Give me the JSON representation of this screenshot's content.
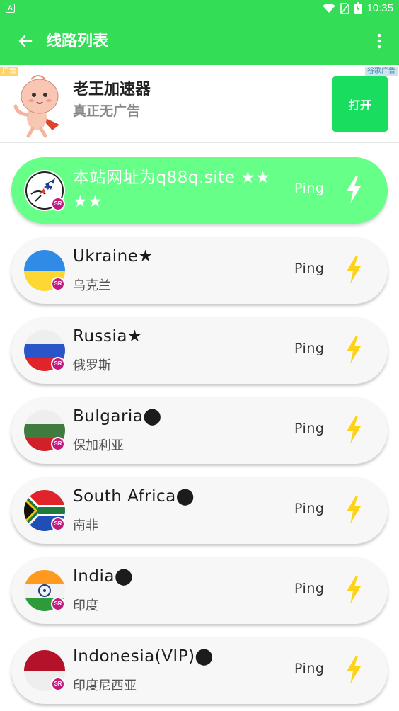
{
  "status_bar": {
    "time": "10:35",
    "app_icon_letter": "A"
  },
  "app_bar": {
    "title": "线路列表",
    "back_icon": "arrow-left-icon",
    "menu_icon": "more-vert-icon"
  },
  "ad": {
    "tag_left": "广告",
    "tag_right": "谷歌广告",
    "title": "老王加速器",
    "subtitle": "真正无广告",
    "button_label": "打开"
  },
  "colors": {
    "primary": "#33dd55",
    "active_card": "#66ff88",
    "bolt_yellow": "#ffd21a",
    "sr_badge": "#c21a7e"
  },
  "servers": [
    {
      "name": "本站网址为q88q.site ★★ ★★",
      "sub": "",
      "ping_label": "Ping",
      "badge": "SR",
      "flag": "rocket",
      "active": true
    },
    {
      "name": "Ukraine★",
      "sub": "乌克兰",
      "ping_label": "Ping",
      "badge": "SR",
      "flag": "ukraine",
      "active": false
    },
    {
      "name": "Russia★",
      "sub": "俄罗斯",
      "ping_label": "Ping",
      "badge": "SR",
      "flag": "russia",
      "active": false
    },
    {
      "name": "Bulgaria⬤",
      "sub": "保加利亚",
      "ping_label": "Ping",
      "badge": "SR",
      "flag": "bulgaria",
      "active": false
    },
    {
      "name": "South Africa⬤",
      "sub": "南非",
      "ping_label": "Ping",
      "badge": "SR",
      "flag": "south-africa",
      "active": false
    },
    {
      "name": "India⬤",
      "sub": "印度",
      "ping_label": "Ping",
      "badge": "SR",
      "flag": "india",
      "active": false
    },
    {
      "name": "Indonesia(VIP)⬤",
      "sub": "印度尼西亚",
      "ping_label": "Ping",
      "badge": "SR",
      "flag": "indonesia",
      "active": false
    }
  ]
}
